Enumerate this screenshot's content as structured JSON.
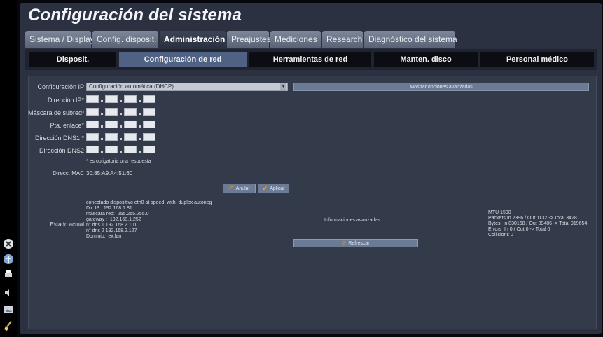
{
  "title": "Configuración del sistema",
  "tabs": [
    {
      "label": "Sistema / Display"
    },
    {
      "label": "Config. disposit."
    },
    {
      "label": "Administración"
    },
    {
      "label": "Preajustes"
    },
    {
      "label": "Mediciones"
    },
    {
      "label": "Research"
    },
    {
      "label": "Diagnóstico del sistema"
    }
  ],
  "subtabs": [
    {
      "label": "Disposit."
    },
    {
      "label": "Configuración de red"
    },
    {
      "label": "Herramientas de red"
    },
    {
      "label": "Manten. disco"
    },
    {
      "label": "Personal médico"
    }
  ],
  "form": {
    "ip_config_label": "Configuración IP",
    "ip_config_value": "Configuración automática (DHCP)",
    "advanced_button": "Mostrar opciones avanzadas",
    "ip_label": "Dirección IP*",
    "mask_label": "Máscara de subred*",
    "gateway_label": "Pta. enlace*",
    "dns1_label": "Dirección DNS1 *",
    "dns2_label": "Dirección DNS2",
    "required_note": "* es obligatoria una respuesta",
    "mac_label": "Direcc. MAC",
    "mac_value": "30:85:A9:A4:51:60",
    "undo_label": "Anular",
    "apply_label": "Aplicar"
  },
  "status": {
    "label": "Estado actual",
    "lines": "conectado dispositivo eth0 at speed  with  duplex autoneg\nDir. IP:  192.168.1.81\nmáscara red:  255.255.255.0\ngateway :  192.168.1.252\nn° dns 1 192.168.2.101\nn° dns 2 192.168.2.127\nDominio:  ex.lan",
    "advanced_info": "Informaciones avanzadas",
    "refresh_label": "Refrescar",
    "stats": "MTU 1500\nPackets In 2396 / Out 1132 -> Total 3428\nBytes  In 830168 / Out 89486 -> Total 919654\nErrors  In 0 / Out 0 -> Total 0\nCollisions 0"
  }
}
